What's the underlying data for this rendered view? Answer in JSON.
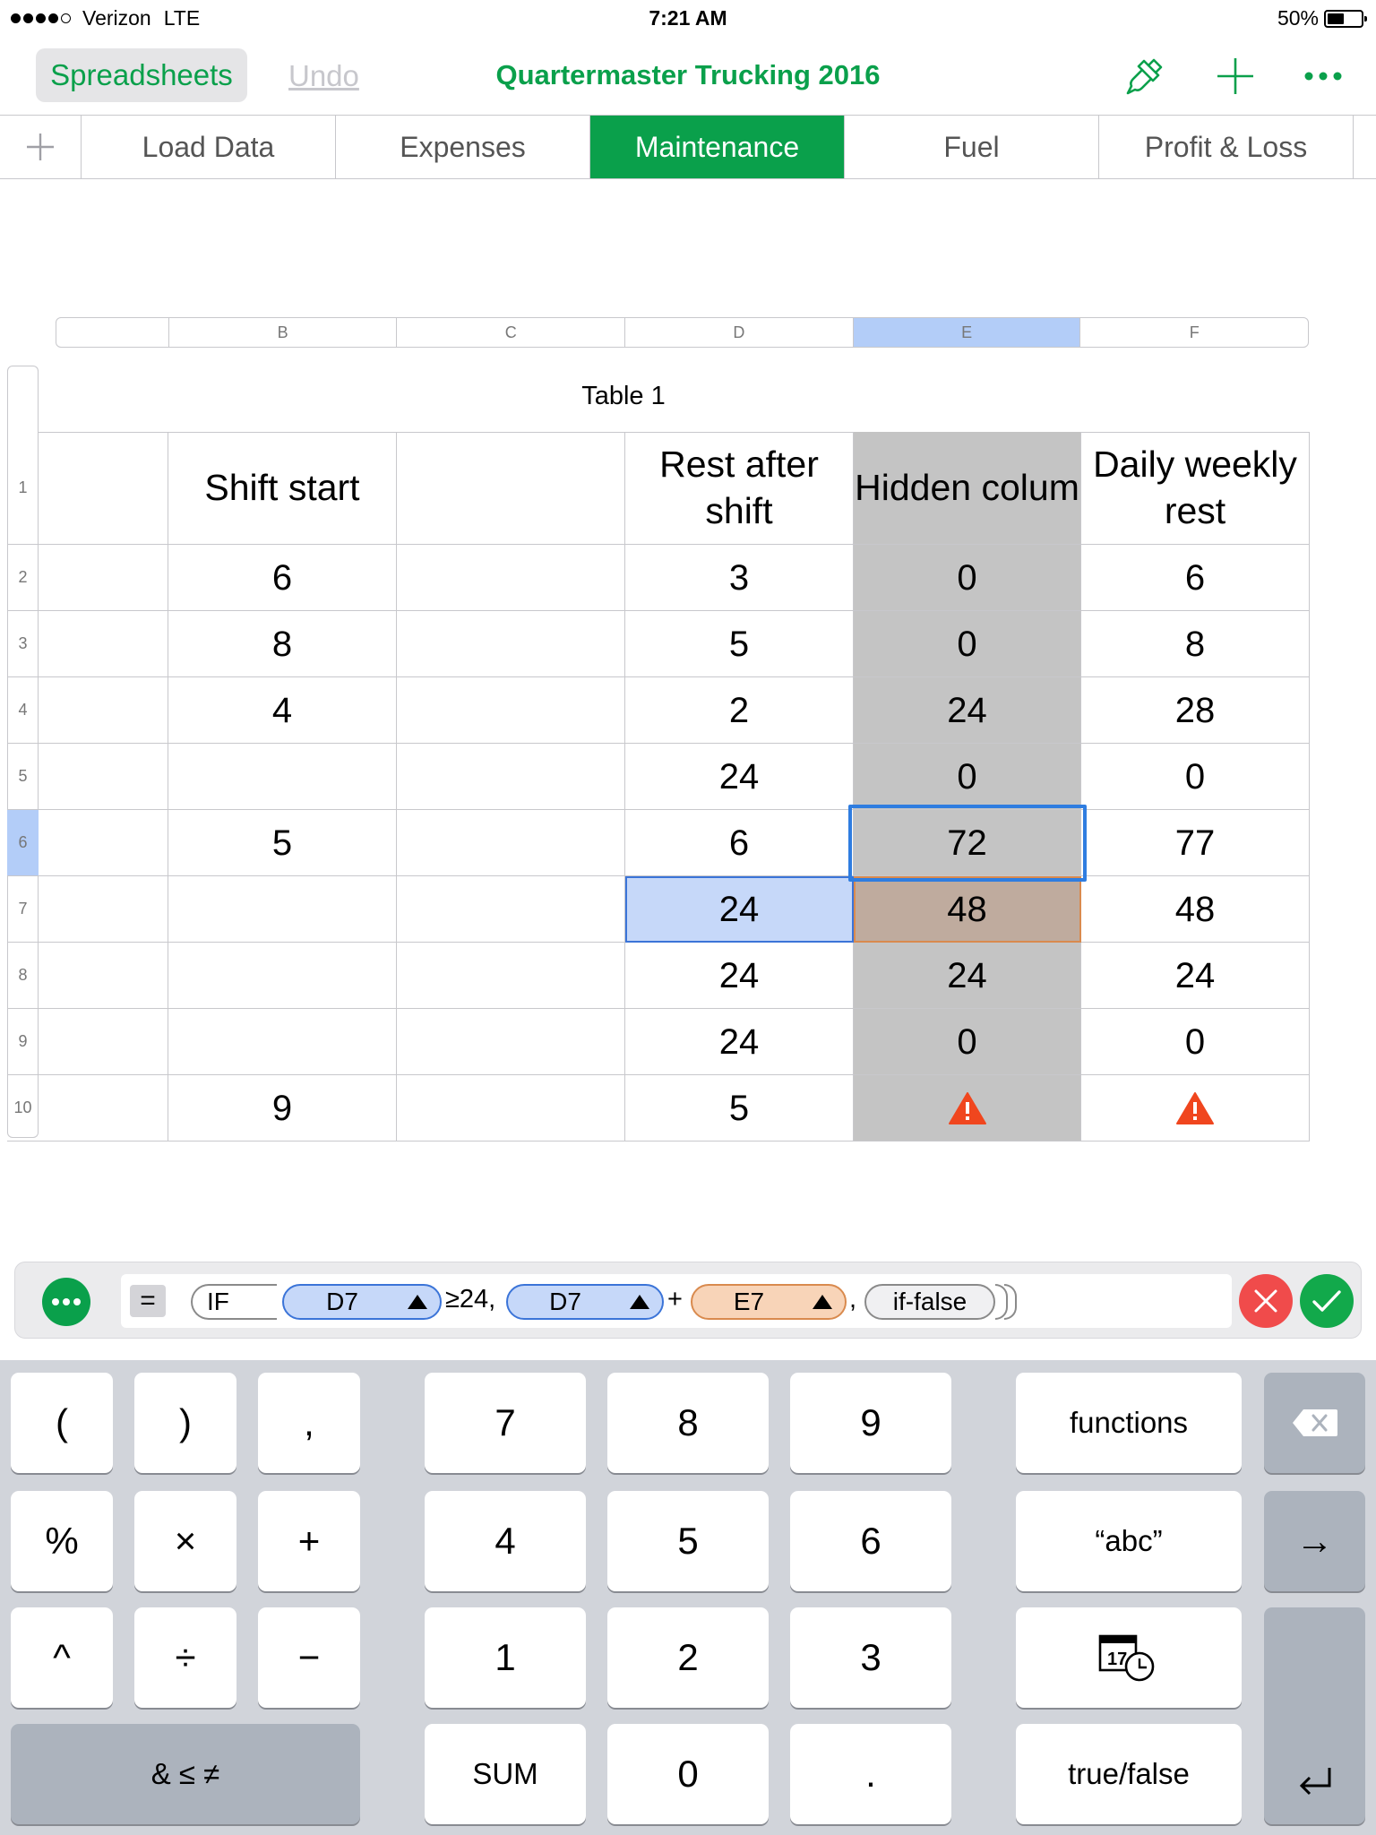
{
  "status_bar": {
    "carrier": "Verizon",
    "network": "LTE",
    "time": "7:21 AM",
    "battery": "50%"
  },
  "toolbar": {
    "back_label": "Spreadsheets",
    "undo_label": "Undo",
    "title": "Quartermaster Trucking 2016"
  },
  "tabs": [
    "Load Data",
    "Expenses",
    "Maintenance",
    "Fuel",
    "Profit & Loss"
  ],
  "active_tab": "Maintenance",
  "columns": [
    "B",
    "C",
    "D",
    "E",
    "F"
  ],
  "selected_column": "E",
  "table": {
    "title": "Table 1",
    "headers": {
      "B": "Shift start",
      "C": "",
      "D": "Rest after shift",
      "E": "Hidden colum",
      "F": "Daily weekly rest"
    },
    "rows": [
      {
        "num": "2",
        "B": "6",
        "C": "",
        "D": "3",
        "E": "0",
        "F": "6"
      },
      {
        "num": "3",
        "B": "8",
        "C": "",
        "D": "5",
        "E": "0",
        "F": "8"
      },
      {
        "num": "4",
        "B": "4",
        "C": "",
        "D": "2",
        "E": "24",
        "F": "28"
      },
      {
        "num": "5",
        "B": "",
        "C": "",
        "D": "24",
        "E": "0",
        "F": "0"
      },
      {
        "num": "6",
        "B": "5",
        "C": "",
        "D": "6",
        "E": "72",
        "F": "77"
      },
      {
        "num": "7",
        "B": "",
        "C": "",
        "D": "24",
        "E": "48",
        "F": "48"
      },
      {
        "num": "8",
        "B": "",
        "C": "",
        "D": "24",
        "E": "24",
        "F": "24"
      },
      {
        "num": "9",
        "B": "",
        "C": "",
        "D": "24",
        "E": "0",
        "F": "0"
      },
      {
        "num": "10",
        "B": "9",
        "C": "",
        "D": "5",
        "E": "!",
        "F": "!"
      }
    ]
  },
  "formula": {
    "equals": "=",
    "function": "IF",
    "ref1": "D7",
    "op1": "≥24,",
    "ref2": "D7",
    "op2": "+",
    "ref3": "E7",
    "comma": ",",
    "placeholder_arg": "if-false"
  },
  "keyboard": {
    "row1": [
      "(",
      ")",
      ",",
      "7",
      "8",
      "9",
      "functions"
    ],
    "row2": [
      "%",
      "×",
      "+",
      "4",
      "5",
      "6",
      "“abc”",
      "→"
    ],
    "row3": [
      "^",
      "÷",
      "−",
      "1",
      "2",
      "3"
    ],
    "calendar_day": "17",
    "row4": [
      "& ≤ ≠",
      "SUM",
      "0",
      ".",
      "true/false"
    ]
  },
  "colors": {
    "accent": "#0aa04b",
    "selection": "#b3cdf8",
    "hidden_column": "#c4c4c4",
    "ref_orange": "#f8d4b8",
    "warning": "#f0461e"
  }
}
